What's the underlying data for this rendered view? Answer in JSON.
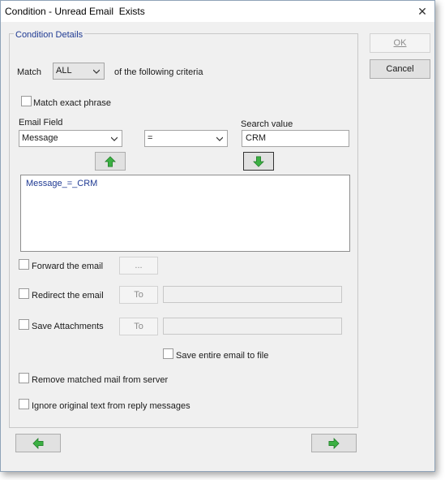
{
  "window": {
    "title": "Condition - Unread Email  Exists",
    "close_glyph": "✕"
  },
  "group": {
    "legend": "Condition Details"
  },
  "match": {
    "label": "Match",
    "selected": "ALL",
    "suffix": "of the following criteria"
  },
  "exact_phrase": {
    "label": "Match exact phrase",
    "checked": false
  },
  "email_field": {
    "label": "Email Field",
    "selected": "Message"
  },
  "operator": {
    "selected": "="
  },
  "search_value": {
    "label": "Search value",
    "value": "CRM"
  },
  "criteria_list": {
    "items": [
      "Message_=_CRM"
    ]
  },
  "forward": {
    "label": "Forward the email",
    "button": "...",
    "checked": false
  },
  "redirect": {
    "label": "Redirect the email",
    "button": "To",
    "value": "",
    "checked": false
  },
  "save_attachments": {
    "label": "Save Attachments",
    "button": "To",
    "value": "",
    "checked": false
  },
  "save_entire": {
    "label": "Save entire email to file",
    "checked": false
  },
  "remove_matched": {
    "label": "Remove matched mail from server",
    "checked": false
  },
  "ignore_original": {
    "label": "Ignore original text from reply messages",
    "checked": false
  },
  "buttons": {
    "ok": "OK",
    "cancel": "Cancel"
  },
  "icons": {
    "move_up": "arrow-up-icon",
    "add_down": "arrow-down-icon",
    "back": "arrow-left-icon",
    "next": "arrow-right-icon",
    "arrow_color": "#3cb043"
  }
}
